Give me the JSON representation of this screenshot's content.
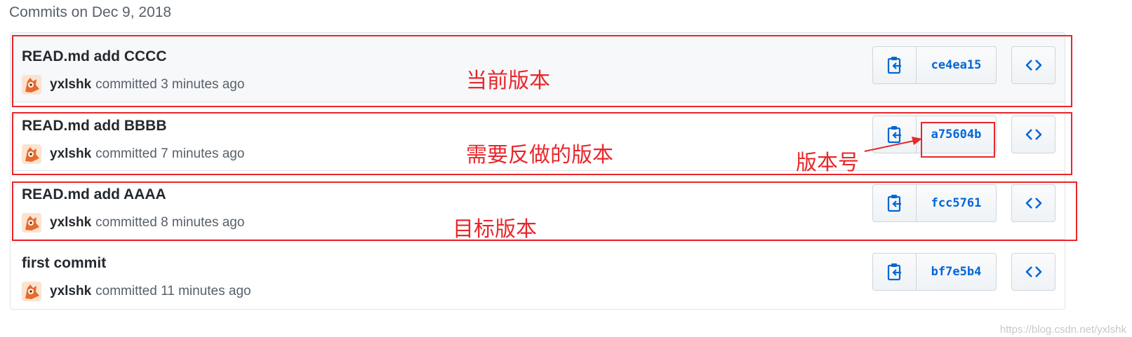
{
  "heading": "Commits on Dec 9, 2018",
  "commits": [
    {
      "title": "READ.md add CCCC",
      "author": "yxlshk",
      "time": "committed 3 minutes ago",
      "sha": "ce4ea15"
    },
    {
      "title": "READ.md add BBBB",
      "author": "yxlshk",
      "time": "committed 7 minutes ago",
      "sha": "a75604b"
    },
    {
      "title": "READ.md add AAAA",
      "author": "yxlshk",
      "time": "committed 8 minutes ago",
      "sha": "fcc5761"
    },
    {
      "title": "first commit",
      "author": "yxlshk",
      "time": "committed 11 minutes ago",
      "sha": "bf7e5b4"
    }
  ],
  "annotations": {
    "current_version": "当前版本",
    "revert_version": "需要反做的版本",
    "version_number": "版本号",
    "target_version": "目标版本"
  },
  "icons": {
    "copy": "clipboard-icon",
    "browse": "code-icon"
  },
  "colors": {
    "link": "#0366d6",
    "annotation": "#e8272b",
    "highlight_row": "#f6f8fa"
  },
  "watermark": "https://blog.csdn.net/yxlshk"
}
